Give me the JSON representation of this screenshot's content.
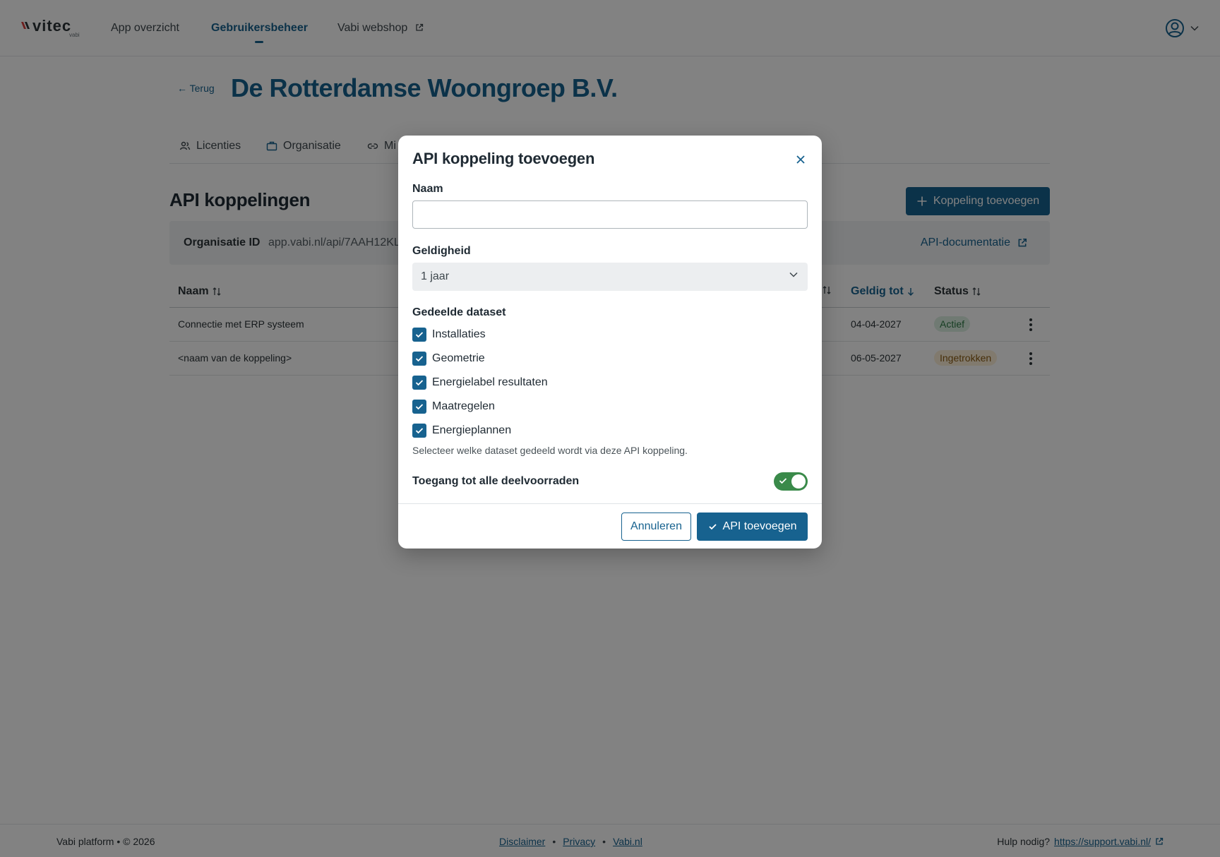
{
  "brand": {
    "logo_text": "vitec",
    "logo_sub": "vabi"
  },
  "nav": {
    "items": [
      {
        "label": "App overzicht"
      },
      {
        "label": "Gebruikersbeheer"
      },
      {
        "label": "Vabi webshop"
      }
    ]
  },
  "page": {
    "back_label": "← Terug",
    "title": "De Rotterdamse Woongroep B.V."
  },
  "tabs": [
    {
      "label": "Licenties",
      "icon": "users-icon"
    },
    {
      "label": "Organisatie",
      "icon": "briefcase-icon"
    },
    {
      "label": "Mi",
      "icon": "link-icon"
    }
  ],
  "section": {
    "title": "API koppelingen",
    "add_button": "Koppeling toevoegen"
  },
  "org": {
    "label": "Organisatie ID",
    "value": "app.vabi.nl/api/7AAH12KL",
    "doc_link": "API-documentatie"
  },
  "table": {
    "columns": {
      "name": "Naam",
      "valid_until": "Geldig tot",
      "status": "Status"
    },
    "rows": [
      {
        "name": "Connectie met ERP systeem",
        "valid_until": "04-04-2027",
        "status": "Actief",
        "status_type": "active"
      },
      {
        "name": "<naam van de koppeling>",
        "valid_until": "06-05-2027",
        "status": "Ingetrokken",
        "status_type": "revoked"
      }
    ]
  },
  "modal": {
    "title": "API koppeling toevoegen",
    "name_label": "Naam",
    "name_value": "",
    "validity_label": "Geldigheid",
    "validity_value": "1 jaar",
    "dataset_label": "Gedeelde dataset",
    "datasets": [
      {
        "label": "Installaties",
        "checked": true
      },
      {
        "label": "Geometrie",
        "checked": true
      },
      {
        "label": "Energielabel resultaten",
        "checked": true
      },
      {
        "label": "Maatregelen",
        "checked": true
      },
      {
        "label": "Energieplannen",
        "checked": true
      }
    ],
    "helper": "Selecteer welke dataset gedeeld wordt via deze API koppeling.",
    "access_label": "Toegang tot alle deelvoorraden",
    "access_on": true,
    "cancel_label": "Annuleren",
    "submit_label": "API toevoegen"
  },
  "footer": {
    "copyright": "Vabi platform • © 2026",
    "links": [
      {
        "label": "Disclaimer"
      },
      {
        "label": "Privacy"
      },
      {
        "label": "Vabi.nl"
      }
    ],
    "separator": "•",
    "help_text": "Hulp nodig?",
    "help_link": "https://support.vabi.nl/"
  },
  "colors": {
    "primary": "#17628f",
    "success": "#3a8a4a",
    "overlay": "rgba(0,0,0,0.49)"
  }
}
